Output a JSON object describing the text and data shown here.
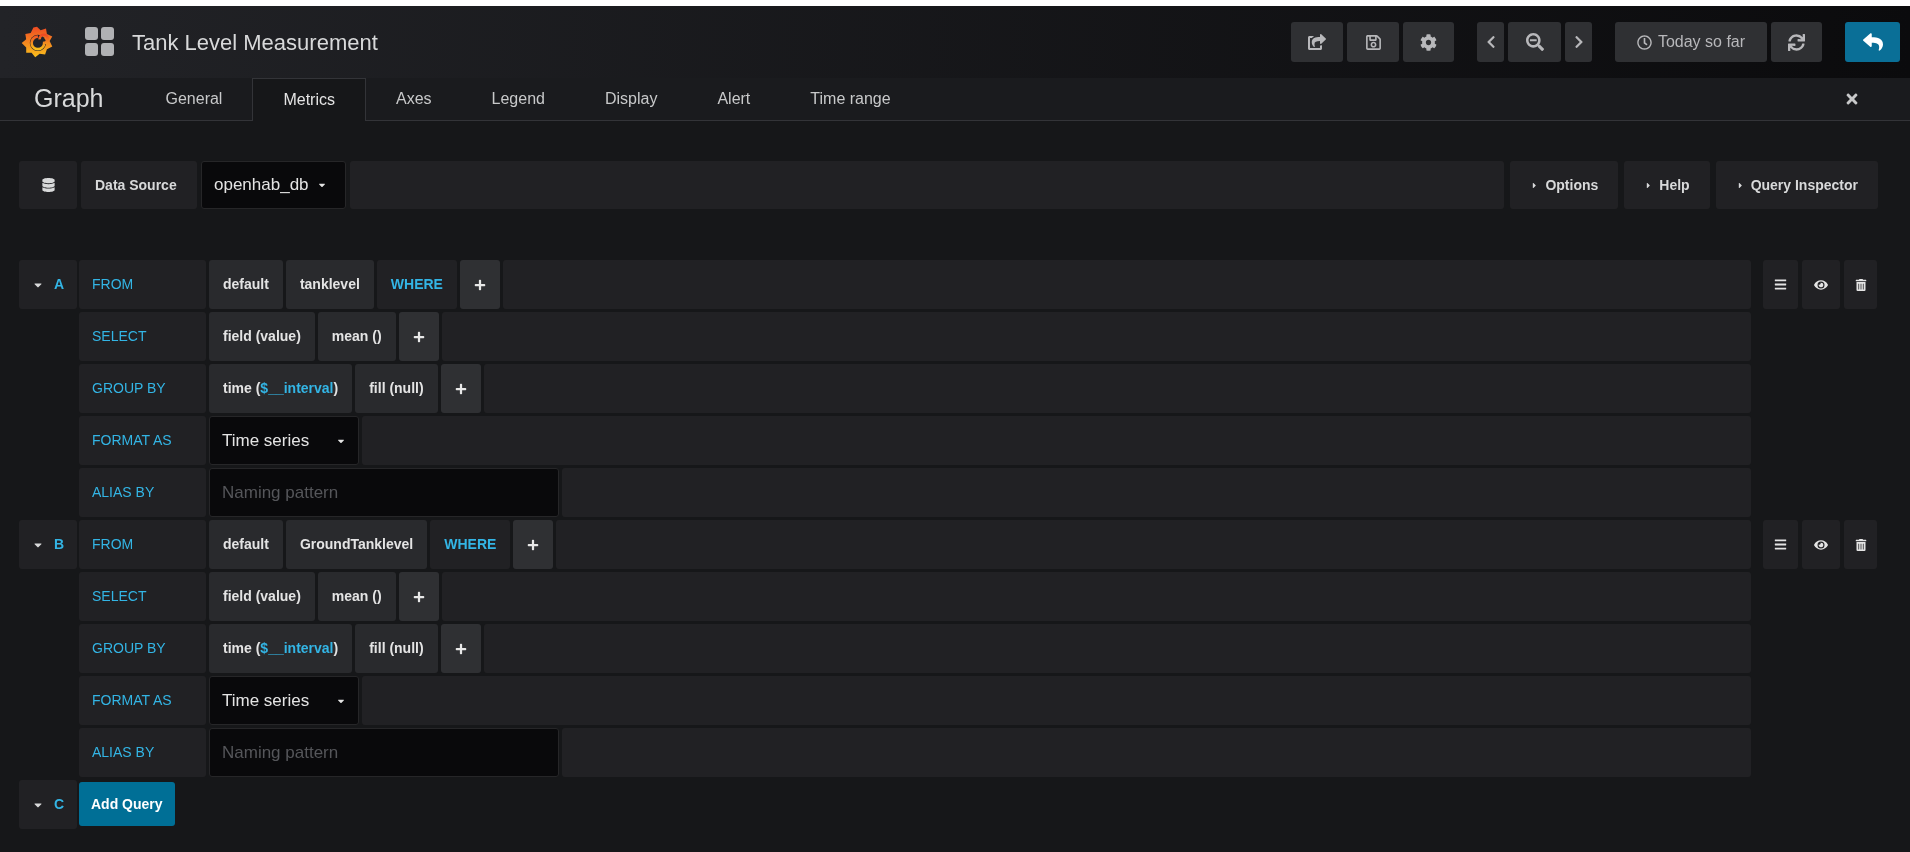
{
  "top_bar": {
    "title": "Tank Level Measurement",
    "time_range": "Today so far"
  },
  "editor": {
    "title": "Graph",
    "tabs": [
      {
        "label": "General",
        "selected": false
      },
      {
        "label": "Metrics",
        "selected": true
      },
      {
        "label": "Axes",
        "selected": false
      },
      {
        "label": "Legend",
        "selected": false
      },
      {
        "label": "Display",
        "selected": false
      },
      {
        "label": "Alert",
        "selected": false
      },
      {
        "label": "Time range",
        "selected": false
      }
    ]
  },
  "data_source": {
    "label": "Data Source",
    "value": "openhab_db",
    "buttons": [
      "Options",
      "Help",
      "Query Inspector"
    ]
  },
  "queries": [
    {
      "letter": "A",
      "expanded": true,
      "rows": [
        {
          "label": "FROM",
          "kind": "segments",
          "segments": [
            {
              "kind": "plain",
              "text": "default"
            },
            {
              "kind": "plain",
              "text": "tanklevel"
            },
            {
              "kind": "keyword",
              "text": "WHERE"
            },
            {
              "kind": "add"
            }
          ]
        },
        {
          "label": "SELECT",
          "kind": "segments",
          "segments": [
            {
              "kind": "plain",
              "parts": [
                {
                  "text": "field (value)",
                  "variable": false
                }
              ]
            },
            {
              "kind": "plain",
              "parts": [
                {
                  "text": "mean ()",
                  "variable": false
                }
              ]
            },
            {
              "kind": "add"
            }
          ]
        },
        {
          "label": "GROUP BY",
          "kind": "segments",
          "segments": [
            {
              "kind": "plain",
              "parts": [
                {
                  "text": "time (",
                  "variable": false
                },
                {
                  "text": "$__interval",
                  "variable": true
                },
                {
                  "text": ")",
                  "variable": false
                }
              ]
            },
            {
              "kind": "plain",
              "parts": [
                {
                  "text": "fill (null)",
                  "variable": false
                }
              ]
            },
            {
              "kind": "add"
            }
          ]
        },
        {
          "label": "FORMAT AS",
          "kind": "select",
          "value": "Time series"
        },
        {
          "label": "ALIAS BY",
          "kind": "input",
          "placeholder": "Naming pattern"
        }
      ]
    },
    {
      "letter": "B",
      "expanded": true,
      "rows": [
        {
          "label": "FROM",
          "kind": "segments",
          "segments": [
            {
              "kind": "plain",
              "text": "default"
            },
            {
              "kind": "plain",
              "text": "GroundTanklevel"
            },
            {
              "kind": "keyword",
              "text": "WHERE"
            },
            {
              "kind": "add"
            }
          ]
        },
        {
          "label": "SELECT",
          "kind": "segments",
          "segments": [
            {
              "kind": "plain",
              "parts": [
                {
                  "text": "field (value)",
                  "variable": false
                }
              ]
            },
            {
              "kind": "plain",
              "parts": [
                {
                  "text": "mean ()",
                  "variable": false
                }
              ]
            },
            {
              "kind": "add"
            }
          ]
        },
        {
          "label": "GROUP BY",
          "kind": "segments",
          "segments": [
            {
              "kind": "plain",
              "parts": [
                {
                  "text": "time (",
                  "variable": false
                },
                {
                  "text": "$__interval",
                  "variable": true
                },
                {
                  "text": ")",
                  "variable": false
                }
              ]
            },
            {
              "kind": "plain",
              "parts": [
                {
                  "text": "fill (null)",
                  "variable": false
                }
              ]
            },
            {
              "kind": "add"
            }
          ]
        },
        {
          "label": "FORMAT AS",
          "kind": "select",
          "value": "Time series"
        },
        {
          "label": "ALIAS BY",
          "kind": "input",
          "placeholder": "Naming pattern"
        }
      ]
    }
  ],
  "add_query": {
    "letter": "C",
    "expanded": true,
    "button": "Add Query"
  }
}
